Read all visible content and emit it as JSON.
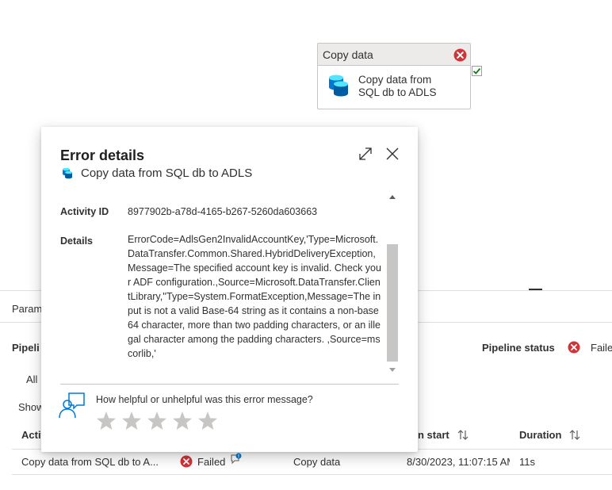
{
  "node": {
    "header": "Copy data",
    "label": "Copy data from SQL db to ADLS",
    "status_icon": "error-circle-icon"
  },
  "background": {
    "params_tab": "Param",
    "pipeline_section": "Pipeli",
    "pipeline_status_label": "Pipeline status",
    "pipeline_status_value": "Faile",
    "filter_all": "All",
    "show_label": "Show",
    "columns": {
      "activity": "Activ",
      "run_start": "n start",
      "duration": "Duration"
    },
    "row": {
      "activity_name": "Copy data from SQL db to A...",
      "status": "Failed",
      "activity_type": "Copy data",
      "run_start": "8/30/2023, 11:07:15 AM",
      "duration": "11s"
    }
  },
  "modal": {
    "title": "Error details",
    "subtitle": "Copy data from SQL db to ADLS",
    "activity_id_label": "Activity ID",
    "activity_id_value": "8977902b-a78d-4165-b267-5260da603663",
    "details_label": "Details",
    "details_value": "ErrorCode=AdlsGen2InvalidAccountKey,'Type=Microsoft.DataTransfer.Common.Shared.HybridDeliveryException,Message=The specified account key is invalid. Check your ADF configuration.,Source=Microsoft.DataTransfer.ClientLibrary,''Type=System.FormatException,Message=The input is not a valid Base-64 string as it contains a non-base 64 character, more than two padding characters, or an illegal character among the padding characters. ,Source=mscorlib,'",
    "feedback_question": "How helpful or unhelpful was this error message?",
    "star_count": 5
  },
  "colors": {
    "error_red": "#d13438",
    "success_green": "#107c10",
    "db_blue": "#0078d4",
    "star_gray": "#c8c6c4"
  }
}
